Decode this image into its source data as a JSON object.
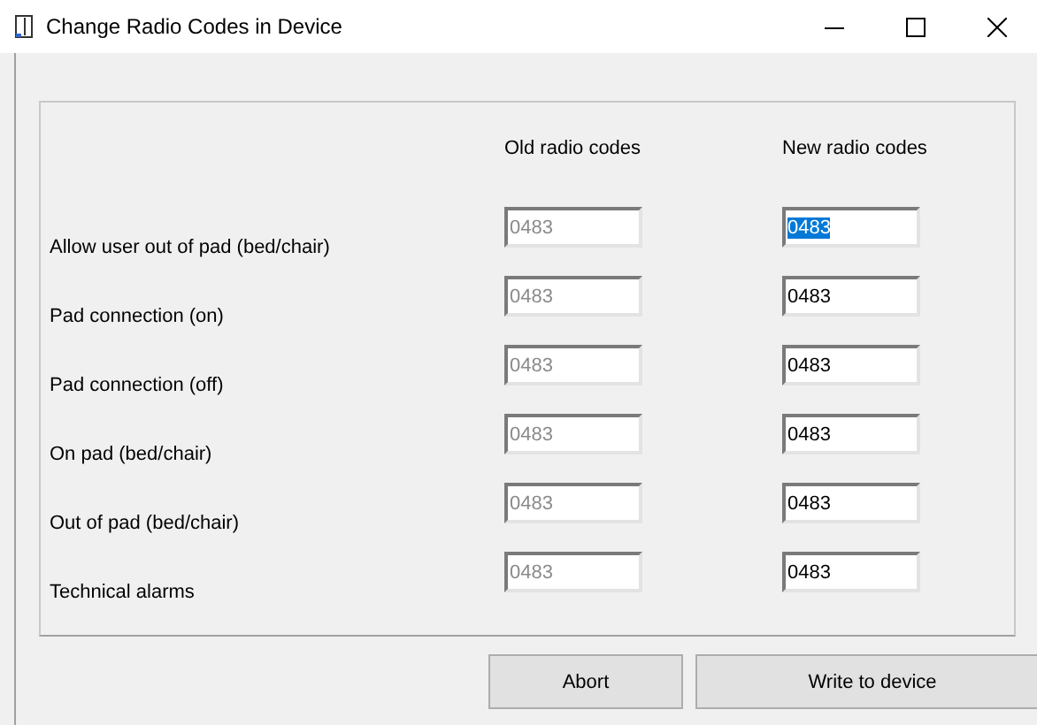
{
  "window": {
    "title": "Change Radio Codes in Device"
  },
  "columns": [
    "Old radio codes",
    "New radio codes"
  ],
  "rows": [
    {
      "label": "Allow user out of pad (bed/chair)",
      "old_code": "0483",
      "new_code": "0483",
      "selected": true
    },
    {
      "label": "Pad connection (on)",
      "old_code": "0483",
      "new_code": "0483",
      "selected": false
    },
    {
      "label": "Pad connection (off)",
      "old_code": "0483",
      "new_code": "0483",
      "selected": false
    },
    {
      "label": "On pad (bed/chair)",
      "old_code": "0483",
      "new_code": "0483",
      "selected": false
    },
    {
      "label": "Out of pad (bed/chair)",
      "old_code": "0483",
      "new_code": "0483",
      "selected": false
    },
    {
      "label": "Technical alarms",
      "old_code": "0483",
      "new_code": "0483",
      "selected": false
    }
  ],
  "buttons": [
    "Abort",
    "Write to device"
  ]
}
